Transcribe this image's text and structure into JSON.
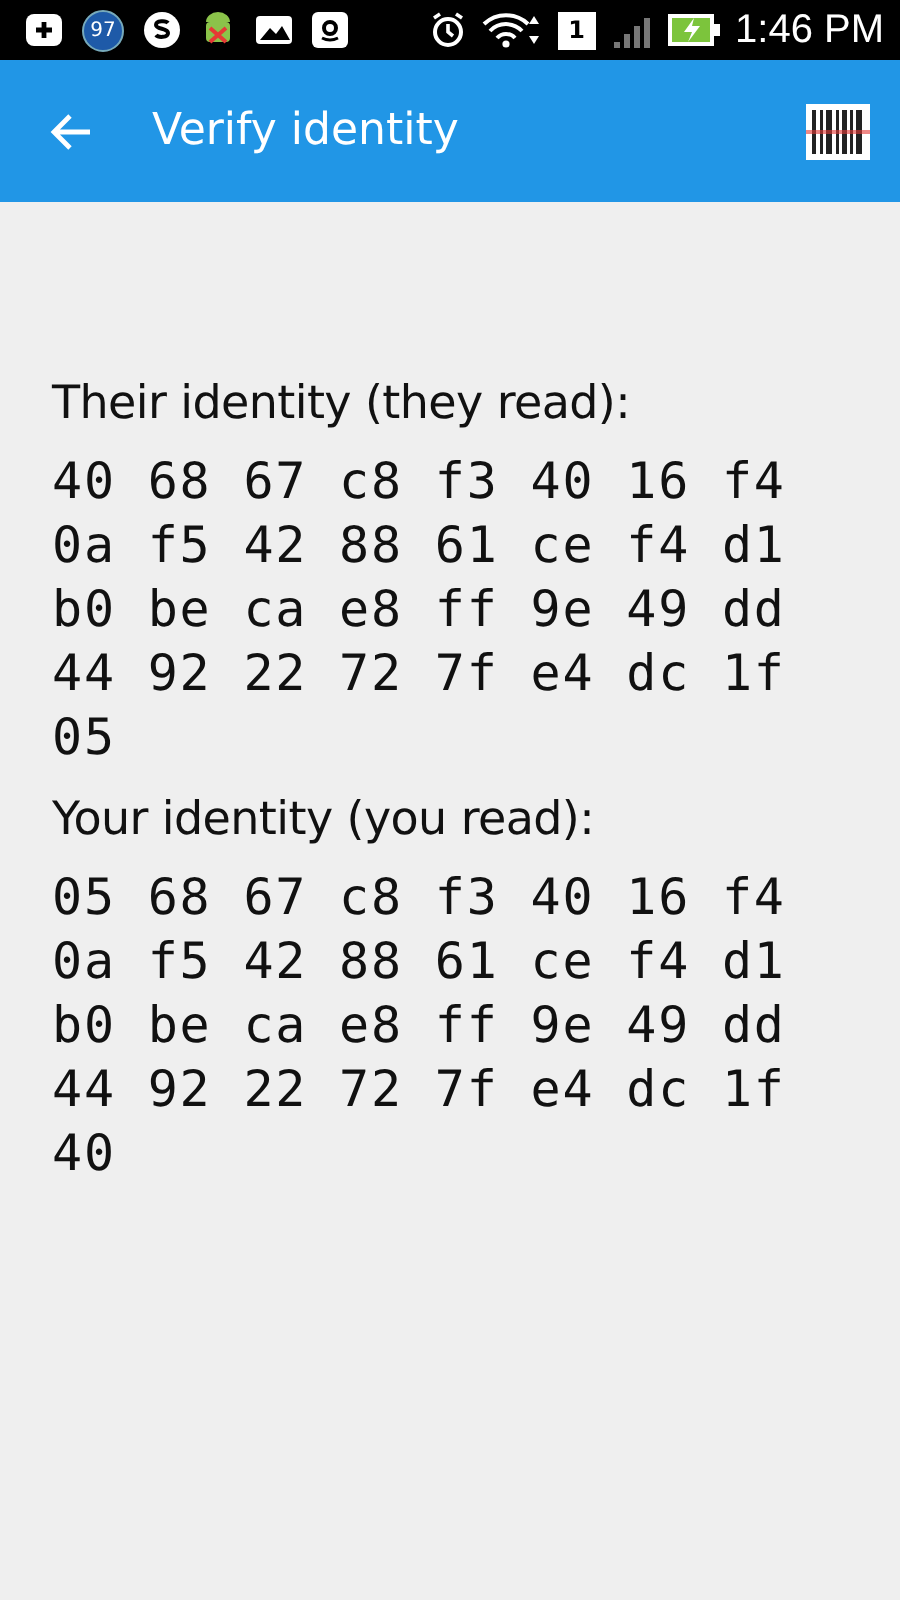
{
  "status_bar": {
    "notification_count": "97",
    "sim_slot": "1",
    "time": "1:46 PM"
  },
  "app_bar": {
    "title": "Verify identity"
  },
  "sections": [
    {
      "heading": "Their identity (they read):",
      "lines": [
        "40 68 67 c8 f3 40 16 f4",
        "0a f5 42 88 61 ce f4 d1",
        "b0 be ca e8 ff 9e 49 dd",
        "44 92 22 72 7f e4 dc 1f",
        "05"
      ]
    },
    {
      "heading": "Your identity (you read):",
      "lines": [
        "05 68 67 c8 f3 40 16 f4",
        "0a f5 42 88 61 ce f4 d1",
        "b0 be ca e8 ff 9e 49 dd",
        "44 92 22 72 7f e4 dc 1f",
        "40"
      ]
    }
  ]
}
